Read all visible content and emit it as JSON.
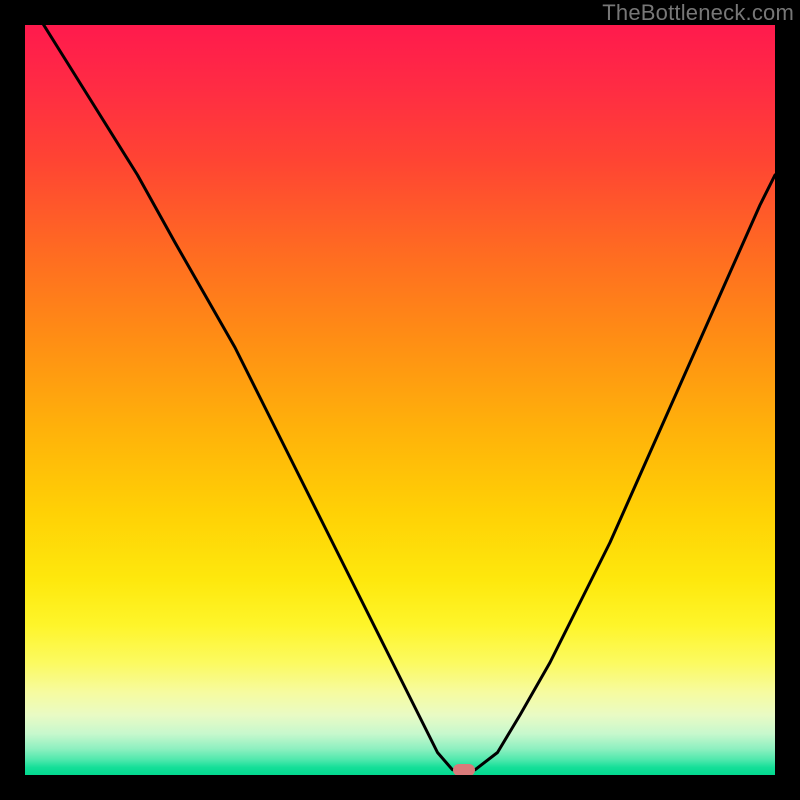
{
  "watermark": "TheBottleneck.com",
  "marker": {
    "x_pct": 58.5,
    "y_pct": 99.3
  },
  "chart_data": {
    "type": "line",
    "title": "",
    "xlabel": "",
    "ylabel": "",
    "xlim": [
      0,
      100
    ],
    "ylim": [
      0,
      100
    ],
    "series": [
      {
        "name": "bottleneck-curve",
        "x": [
          0,
          5,
          10,
          15,
          20,
          24,
          28,
          32,
          36,
          40,
          44,
          48,
          52,
          55,
          57,
          60,
          63,
          66,
          70,
          74,
          78,
          82,
          86,
          90,
          94,
          98,
          100
        ],
        "values": [
          104,
          96,
          88,
          80,
          71,
          64,
          57,
          49,
          41,
          33,
          25,
          17,
          9,
          3,
          0.7,
          0.7,
          3,
          8,
          15,
          23,
          31,
          40,
          49,
          58,
          67,
          76,
          80
        ]
      }
    ],
    "background_gradient_stops": [
      {
        "pct": 0,
        "color": "#ff1a4d"
      },
      {
        "pct": 50,
        "color": "#ffb20a"
      },
      {
        "pct": 80,
        "color": "#fef52a"
      },
      {
        "pct": 100,
        "color": "#02d98f"
      }
    ],
    "marker": {
      "x": 58.5,
      "y": 0.7
    }
  }
}
